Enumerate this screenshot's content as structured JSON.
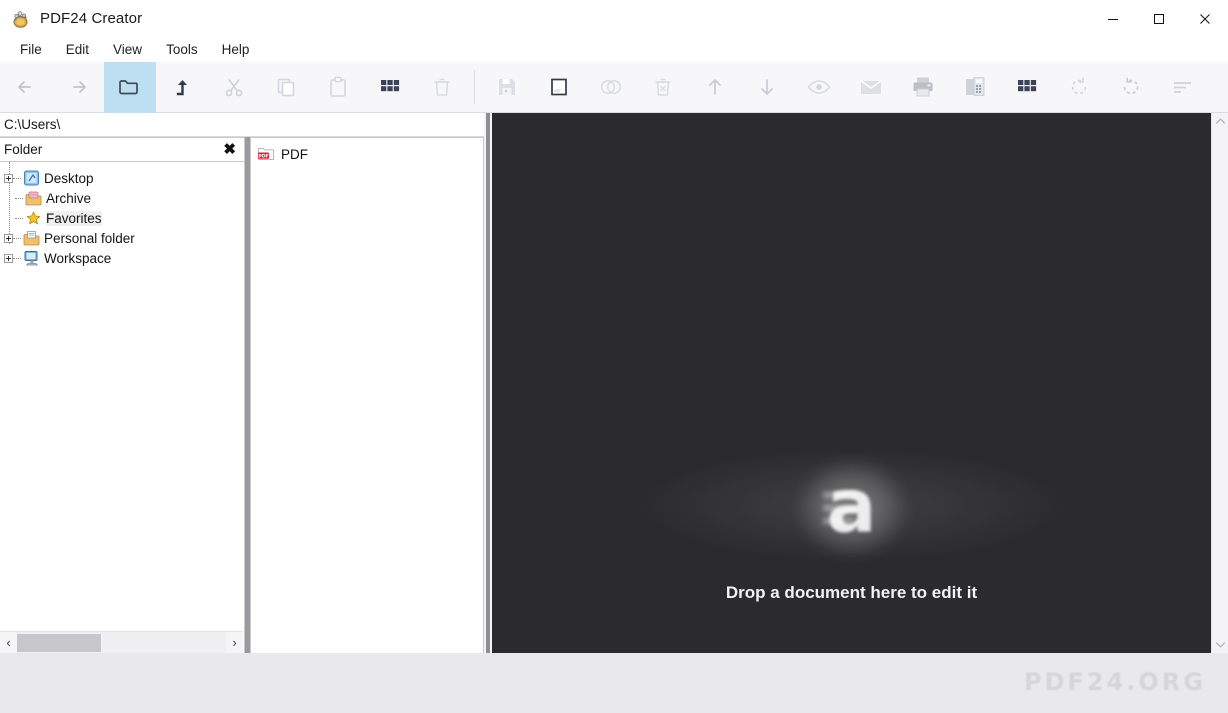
{
  "window": {
    "title": "PDF24 Creator",
    "app_icon": "pdf24-logo-icon",
    "controls": {
      "minimize": "minimize-icon",
      "maximize": "maximize-icon",
      "close": "close-icon"
    }
  },
  "menubar": {
    "items": [
      {
        "label": "File"
      },
      {
        "label": "Edit"
      },
      {
        "label": "View"
      },
      {
        "label": "Tools"
      },
      {
        "label": "Help"
      }
    ]
  },
  "toolbar": {
    "groups": [
      {
        "buttons": [
          {
            "name": "back-arrow-icon",
            "tooltip": "Back",
            "active": false
          },
          {
            "name": "forward-arrow-icon",
            "tooltip": "Forward",
            "active": false
          },
          {
            "name": "folder-icon",
            "tooltip": "Folder",
            "active": true
          },
          {
            "name": "up-folder-icon",
            "tooltip": "Up",
            "active": false
          },
          {
            "name": "scissors-icon",
            "tooltip": "Cut",
            "active": false
          },
          {
            "name": "copy-icon",
            "tooltip": "Copy",
            "active": false
          },
          {
            "name": "paste-icon",
            "tooltip": "Paste",
            "active": false
          },
          {
            "name": "grid-icon",
            "tooltip": "Select all",
            "active": false
          },
          {
            "name": "trash-icon",
            "tooltip": "Delete",
            "active": false
          }
        ]
      },
      {
        "buttons": [
          {
            "name": "save-icon",
            "tooltip": "Save",
            "active": false
          },
          {
            "name": "page-icon",
            "tooltip": "New page",
            "active": false
          },
          {
            "name": "merge-icon",
            "tooltip": "Merge",
            "active": false
          },
          {
            "name": "delete-page-icon",
            "tooltip": "Delete page",
            "active": false
          },
          {
            "name": "move-up-icon",
            "tooltip": "Move up",
            "active": false
          },
          {
            "name": "move-down-icon",
            "tooltip": "Move down",
            "active": false
          },
          {
            "name": "preview-eye-icon",
            "tooltip": "Preview",
            "active": false
          },
          {
            "name": "mail-icon",
            "tooltip": "Send by mail",
            "active": false
          },
          {
            "name": "print-icon",
            "tooltip": "Print",
            "active": false
          },
          {
            "name": "fax-icon",
            "tooltip": "Fax",
            "active": false
          },
          {
            "name": "grid-icon-2",
            "tooltip": "Select all pages",
            "active": false
          },
          {
            "name": "rotate-left-icon",
            "tooltip": "Rotate left",
            "active": false
          },
          {
            "name": "rotate-right-icon",
            "tooltip": "Rotate right",
            "active": false
          },
          {
            "name": "sort-icon",
            "tooltip": "Sort",
            "active": false
          }
        ]
      }
    ]
  },
  "path_bar": {
    "value": "C:\\Users\\"
  },
  "tree_panel": {
    "header": {
      "label": "Folder",
      "close": "✖"
    },
    "items": [
      {
        "label": "Desktop",
        "icon": "desktop-icon",
        "expandable": true,
        "selected": false
      },
      {
        "label": "Archive",
        "icon": "archive-folder-icon",
        "expandable": false,
        "selected": false
      },
      {
        "label": "Favorites",
        "icon": "star-icon",
        "expandable": false,
        "selected": true
      },
      {
        "label": "Personal folder",
        "icon": "personal-folder-icon",
        "expandable": true,
        "selected": false
      },
      {
        "label": "Workspace",
        "icon": "workspace-icon",
        "expandable": true,
        "selected": false
      }
    ],
    "hscroll": {
      "left_arrow": "‹",
      "right_arrow": "›",
      "thumb_percent": 40
    }
  },
  "file_panel": {
    "items": [
      {
        "label": "PDF",
        "icon": "pdf-folder-icon",
        "badge": "PDF"
      }
    ]
  },
  "drop_area": {
    "message": "Drop a document here to edit it",
    "logo_glyph": "a",
    "background": "#2b2b2e"
  },
  "scrollbar": {
    "up_arrow": "up-chevron-icon",
    "down_arrow": "down-chevron-icon"
  },
  "footer": {
    "watermark": "PDF24.ORG"
  },
  "colors": {
    "accent_active": "#bedef2",
    "toolbar_bg": "#f7f7f9",
    "drop_bg": "#2b2b2e",
    "footer_bg": "#e9e8eb",
    "watermark": "#d6d5d9",
    "pdf_badge": "#e01f3d"
  }
}
